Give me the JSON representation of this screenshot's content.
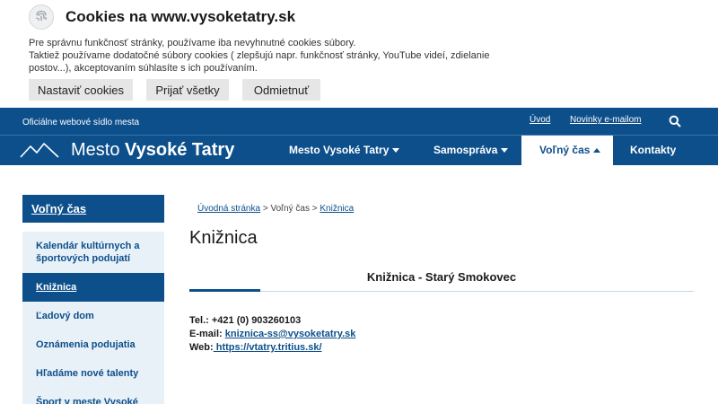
{
  "cookie_banner": {
    "title": "Cookies na www.vysoketatry.sk",
    "text_line1": "Pre správnu funkčnosť stránky, používame iba nevyhnutné cookies súbory.",
    "text_line2": "Taktiež používame dodatočné súbory cookies ( zlepšujú napr. funkčnosť stránky, YouTube videí, zdielanie postov...), akceptovaním súhlasíte s ich používaním.",
    "btn_settings": "Nastaviť cookies",
    "btn_accept": "Prijať všetky",
    "btn_reject": "Odmietnuť",
    "icon": "fingerprint-icon"
  },
  "topbar": {
    "official": "Oficiálne webové sídlo mesta",
    "link_home": "Úvod",
    "link_newsletter": "Novinky e-mailom",
    "search_icon": "search-icon"
  },
  "logo": {
    "prefix": "Mesto ",
    "name": "Vysoké Tatry"
  },
  "nav": {
    "items": [
      {
        "label": "Mesto Vysoké Tatry"
      },
      {
        "label": "Samospráva"
      },
      {
        "label": "Voľný čas"
      },
      {
        "label": "Kontakty"
      }
    ]
  },
  "sidebar": {
    "heading": "Voľný čas",
    "items": [
      {
        "label": "Kalendár kultúrnych a športových podujatí"
      },
      {
        "label": "Knižnica"
      },
      {
        "label": "Ľadový dom"
      },
      {
        "label": "Oznámenia podujatia"
      },
      {
        "label": "Hľadáme nové talenty"
      },
      {
        "label": "Šport v meste Vysoké"
      }
    ]
  },
  "breadcrumb": {
    "home": "Úvodná stránka",
    "sep1": " > ",
    "section": "Voľný čas",
    "sep2": " > ",
    "current": "Knižnica"
  },
  "main": {
    "title": "Knižnica",
    "tab": "Knižnica - Starý Smokovec",
    "phone_label": "Tel.: ",
    "phone": "+421 (0) 903260103",
    "email_label": "E-mail: ",
    "email": "kniznica-ss@vysoketatry.sk",
    "web_label": "Web:",
    "web": " https://vtatry.tritius.sk/"
  },
  "colors": {
    "brand": "#0d4f8b",
    "sidebar_bg": "#e9f1f8"
  }
}
